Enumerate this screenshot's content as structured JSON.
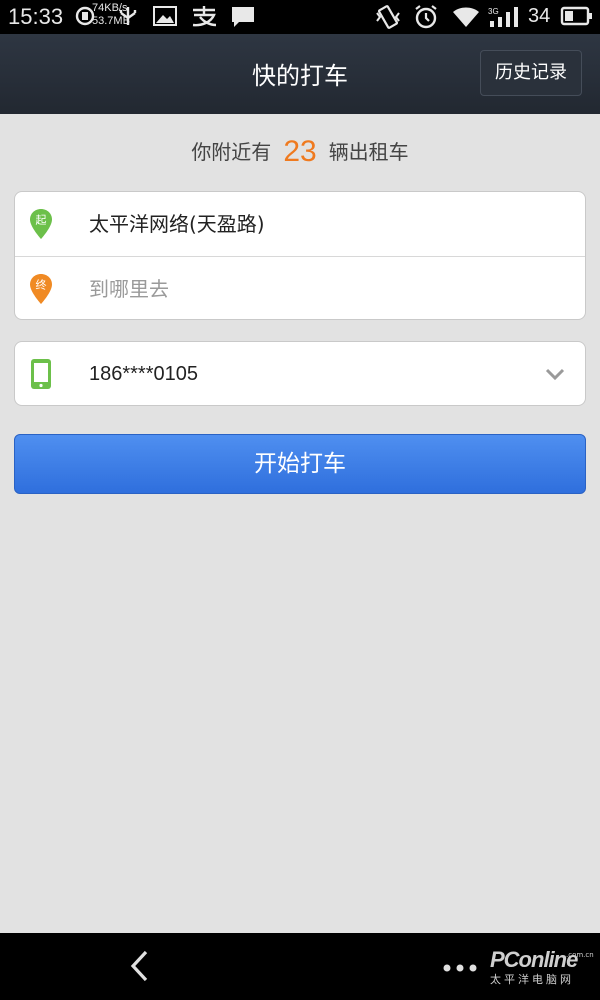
{
  "status_bar": {
    "time": "15:33",
    "net_speed": "74KB/s",
    "data_used": "53.7MB",
    "battery": "34",
    "icons": [
      "sync-icon",
      "usb-icon",
      "image-icon",
      "alipay-icon",
      "message-icon",
      "vibrate-icon",
      "alarm-icon",
      "wifi-icon",
      "signal-3g-icon",
      "battery-icon"
    ]
  },
  "header": {
    "title": "快的打车",
    "history_label": "历史记录"
  },
  "nearby": {
    "prefix": "你附近有",
    "count": "23",
    "suffix": "辆出租车"
  },
  "route": {
    "start_icon_label": "起",
    "start_value": "太平洋网络(天盈路)",
    "end_icon_label": "终",
    "end_placeholder": "到哪里去",
    "start_color": "#6cc04a",
    "end_color": "#f08a24"
  },
  "phone": {
    "value": "186****0105",
    "icon": "mobile-phone-icon",
    "color": "#6cc04a"
  },
  "actions": {
    "start_label": "开始打车"
  },
  "nav": {
    "back_icon": "back-icon",
    "more_icon": "more-icon"
  },
  "watermark": {
    "logo": "PConline",
    "sub": "太平洋电脑网",
    "domain": ".com.cn"
  }
}
